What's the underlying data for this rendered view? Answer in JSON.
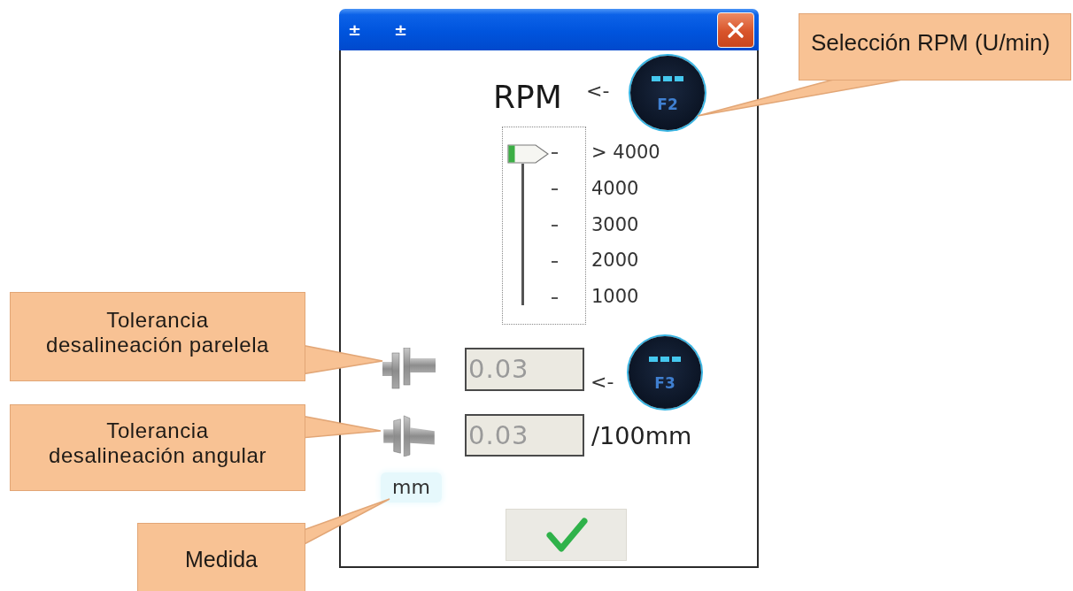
{
  "window": {
    "title_glyphs": [
      "±",
      "±"
    ]
  },
  "rpm": {
    "label": "RPM",
    "arrow": "<-",
    "key": "F2",
    "slider": {
      "level": 1,
      "stops": [
        "> 4000",
        "4000",
        "3000",
        "2000",
        "1000"
      ]
    }
  },
  "tolerances": [
    {
      "kind": "parallel",
      "value": "0.03",
      "arrow": "<-",
      "key": "F3"
    },
    {
      "kind": "angular",
      "value": "0.03",
      "unit": "/100mm"
    }
  ],
  "units_button": "mm",
  "callouts": [
    {
      "text": "Selección RPM (U/min)"
    },
    {
      "text": "Tolerancia\ndesalineación parelela"
    },
    {
      "text": "Tolerancia\ndesalineación angular"
    },
    {
      "text": "Medida"
    }
  ]
}
